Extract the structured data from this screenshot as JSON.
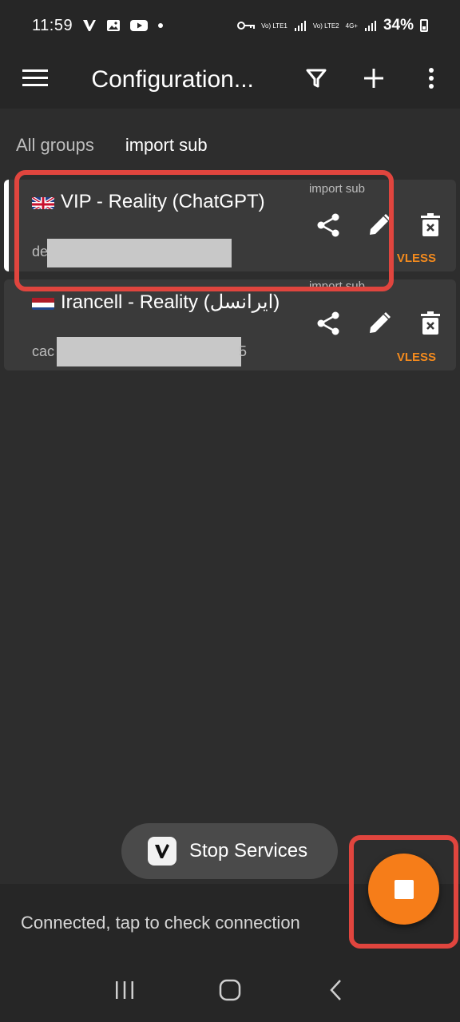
{
  "status_bar": {
    "time": "11:59",
    "net1": "Vo) LTE1",
    "net2": "Vo) LTE2",
    "net3": "4G+",
    "battery": "34%"
  },
  "toolbar": {
    "title": "Configuration...",
    "menu_icon": "hamburger-menu-icon",
    "filter_icon": "filter-icon",
    "add_icon": "plus-icon",
    "more_icon": "more-vert-icon"
  },
  "tabs": [
    {
      "label": "All groups",
      "active": false
    },
    {
      "label": "import sub",
      "active": true
    }
  ],
  "servers": [
    {
      "flag": "uk-flag-icon",
      "name": "VIP - Reality (ChatGPT)",
      "group": "import sub",
      "address_visible": "de",
      "protocol": "VLESS",
      "selected": true
    },
    {
      "flag": "netherlands-flag-icon",
      "name": "Irancell - Reality (ایرانسل)",
      "group": "import sub",
      "address_visible": "cac",
      "address_suffix": "5",
      "protocol": "VLESS",
      "selected": false
    }
  ],
  "toast": {
    "text": "Stop Services"
  },
  "bottom": {
    "status": "Connected, tap to check connection"
  },
  "colors": {
    "accent": "#f67d19",
    "protocol": "#f28a1e",
    "highlight": "#e0453e",
    "background": "#2d2d2d",
    "card": "#3a3a3a"
  }
}
